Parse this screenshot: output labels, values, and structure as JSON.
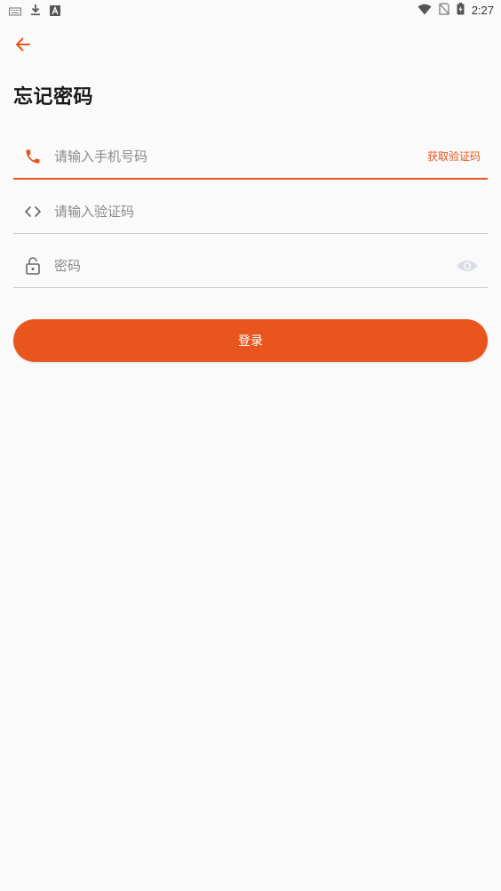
{
  "status_bar": {
    "time": "2:27",
    "left_icons": [
      "keyboard-icon",
      "download-icon",
      "app-a-icon"
    ],
    "right_icons": [
      "wifi-icon",
      "no-sim-icon",
      "battery-icon"
    ]
  },
  "header": {
    "back_icon": "arrow-left-icon",
    "title": "忘记密码"
  },
  "form": {
    "phone": {
      "icon": "phone-icon",
      "placeholder": "请输入手机号码",
      "value": "",
      "action_label": "获取验证码"
    },
    "code": {
      "icon": "code-brackets-icon",
      "placeholder": "请输入验证码",
      "value": ""
    },
    "password": {
      "icon": "lock-icon",
      "placeholder": "密码",
      "value": "",
      "toggle_icon": "eye-icon"
    },
    "submit_label": "登录"
  },
  "colors": {
    "accent": "#e8561e",
    "background": "#fafafa",
    "divider": "#c8c8c8",
    "placeholder": "#8a8a8a"
  }
}
